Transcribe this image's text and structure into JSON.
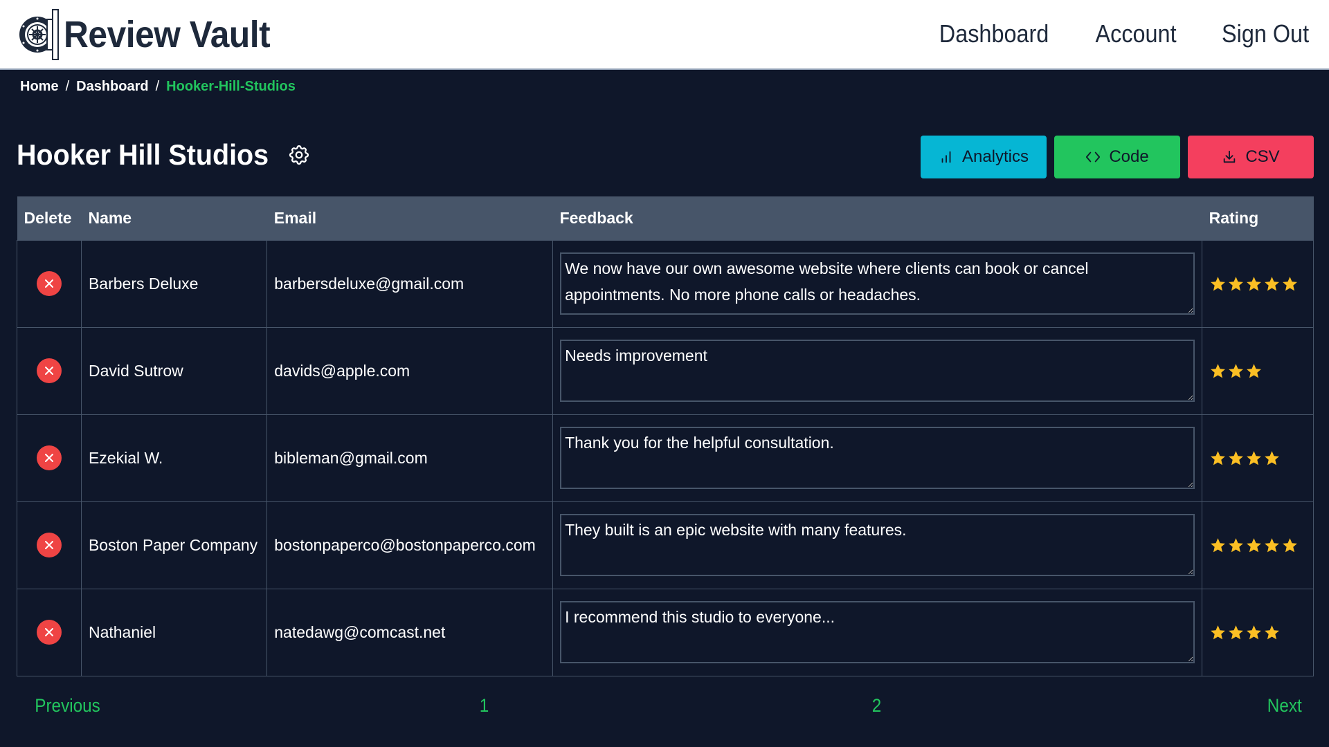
{
  "header": {
    "brand": "Review Vault",
    "nav": [
      {
        "label": "Dashboard"
      },
      {
        "label": "Account"
      },
      {
        "label": "Sign Out"
      }
    ]
  },
  "breadcrumb": {
    "items": [
      "Home",
      "Dashboard"
    ],
    "separator": "/",
    "current": "Hooker-Hill-Studios"
  },
  "page": {
    "title": "Hooker Hill Studios",
    "settings_icon": "gear-icon"
  },
  "actions": {
    "analytics": {
      "label": "Analytics",
      "icon": "bar-chart-icon",
      "color": "#06b6d4"
    },
    "code": {
      "label": "Code",
      "icon": "code-icon",
      "color": "#22c55e"
    },
    "csv": {
      "label": "CSV",
      "icon": "download-icon",
      "color": "#f43f5e"
    }
  },
  "table": {
    "columns": [
      "Delete",
      "Name",
      "Email",
      "Feedback",
      "Rating"
    ],
    "rows": [
      {
        "name": "Barbers Deluxe",
        "email": "barbersdeluxe@gmail.com",
        "feedback": "We now have our own awesome website where clients can book or cancel appointments. No more phone calls or headaches.",
        "rating": 5
      },
      {
        "name": "David Sutrow",
        "email": "davids@apple.com",
        "feedback": "Needs improvement",
        "rating": 3
      },
      {
        "name": "Ezekial W.",
        "email": "bibleman@gmail.com",
        "feedback": "Thank you for the helpful consultation.",
        "rating": 4
      },
      {
        "name": "Boston Paper Company",
        "email": "bostonpaperco@bostonpaperco.com",
        "feedback": "They built is an epic website with many features.",
        "rating": 5
      },
      {
        "name": "Nathaniel",
        "email": "natedawg@comcast.net",
        "feedback": "I recommend this studio to everyone...",
        "rating": 4
      }
    ]
  },
  "pagination": {
    "previous": "Previous",
    "pages": [
      "1",
      "2"
    ],
    "next": "Next"
  },
  "colors": {
    "background": "#0f172a",
    "accent": "#22c55e",
    "table_header": "#475569",
    "delete": "#ef4444",
    "star": "#fbbf24"
  }
}
